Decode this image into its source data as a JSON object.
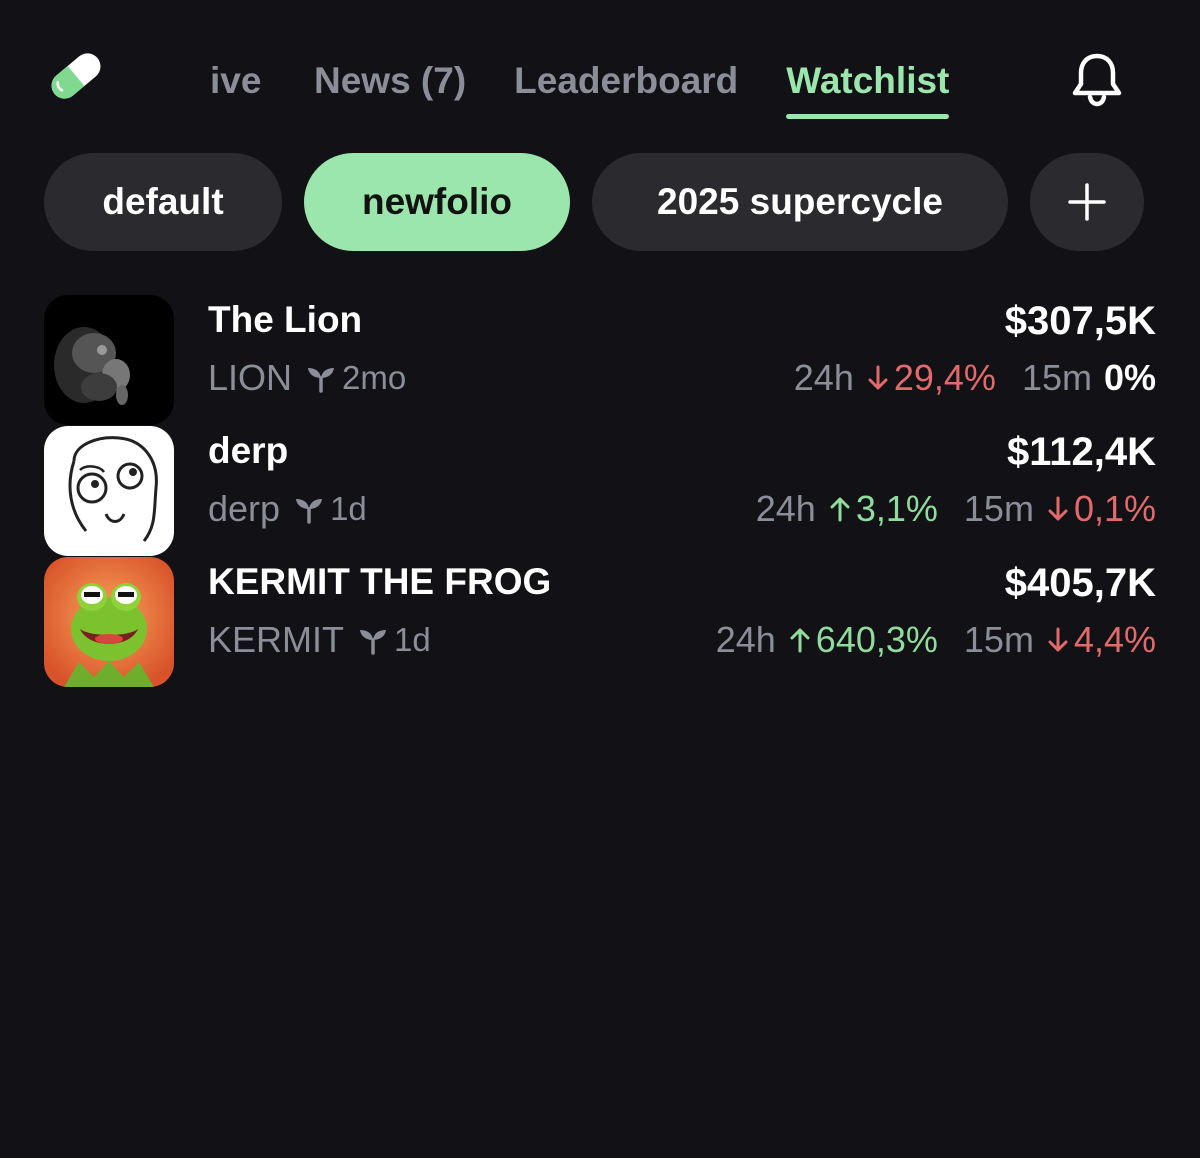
{
  "header": {
    "logo": "pill-capsule-logo",
    "tabs": [
      {
        "label": "ive",
        "active": false
      },
      {
        "label": "News (7)",
        "active": false
      },
      {
        "label": "Leaderboard",
        "active": false
      },
      {
        "label": "Watchlist",
        "active": true
      }
    ],
    "bell_icon": "bell-icon"
  },
  "portfolios": {
    "chips": [
      {
        "label": "default",
        "active": false
      },
      {
        "label": "newfolio",
        "active": true
      },
      {
        "label": "2025 supercycle",
        "active": false
      }
    ],
    "add_icon": "plus-icon"
  },
  "tokens": [
    {
      "name": "The Lion",
      "ticker": "LION",
      "age": "2mo",
      "price": "$307,5K",
      "label_24h": "24h",
      "change_24h": "29,4%",
      "dir_24h": "down",
      "label_15m": "15m",
      "change_15m": "0%",
      "dir_15m": "flat"
    },
    {
      "name": "derp",
      "ticker": "derp",
      "age": "1d",
      "price": "$112,4K",
      "label_24h": "24h",
      "change_24h": "3,1%",
      "dir_24h": "up",
      "label_15m": "15m",
      "change_15m": "0,1%",
      "dir_15m": "down"
    },
    {
      "name": "KERMIT THE FROG",
      "ticker": "KERMIT",
      "age": "1d",
      "price": "$405,7K",
      "label_24h": "24h",
      "change_24h": "640,3%",
      "dir_24h": "up",
      "label_15m": "15m",
      "change_15m": "4,4%",
      "dir_15m": "down"
    }
  ],
  "colors": {
    "background": "#111116",
    "accent": "#9be6ac",
    "positive": "#8fdc9c",
    "negative": "#e36a6a",
    "muted_text": "#8b8e99",
    "chip_bg": "#2a2a2f"
  }
}
